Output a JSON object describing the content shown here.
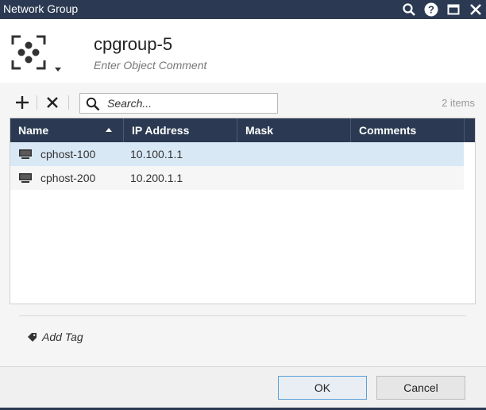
{
  "window": {
    "title": "Network Group"
  },
  "header": {
    "object_name": "cpgroup-5",
    "comment_placeholder": "Enter Object Comment"
  },
  "toolbar": {
    "search_placeholder": "Search...",
    "items_count": "2 items"
  },
  "grid": {
    "columns": [
      "Name",
      "IP Address",
      "Mask",
      "Comments"
    ],
    "sort_column": "Name",
    "sort_direction": "ascending",
    "rows": [
      {
        "name": "cphost-100",
        "ip": "10.100.1.1",
        "mask": "",
        "comments": "",
        "selected": true
      },
      {
        "name": "cphost-200",
        "ip": "10.200.1.1",
        "mask": "",
        "comments": "",
        "selected": false
      }
    ]
  },
  "tags": {
    "add_label": "Add Tag"
  },
  "footer": {
    "ok_label": "OK",
    "cancel_label": "Cancel"
  },
  "colors": {
    "titlebar": "#2b3a52",
    "selection": "#d9e8f5",
    "ok_border": "#5aa0d8"
  }
}
